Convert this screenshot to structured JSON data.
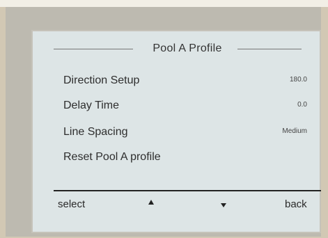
{
  "screen": {
    "title": "Pool A Profile"
  },
  "menu": {
    "items": [
      {
        "label": "Direction Setup",
        "value": "180.0"
      },
      {
        "label": "Delay Time",
        "value": "0.0"
      },
      {
        "label": "Line Spacing",
        "value": "Medium"
      },
      {
        "label": "Reset Pool A profile",
        "value": ""
      }
    ]
  },
  "softkeys": {
    "select_label": "select",
    "up_icon": "triangle-up",
    "down_icon": "triangle-down",
    "back_label": "back"
  }
}
